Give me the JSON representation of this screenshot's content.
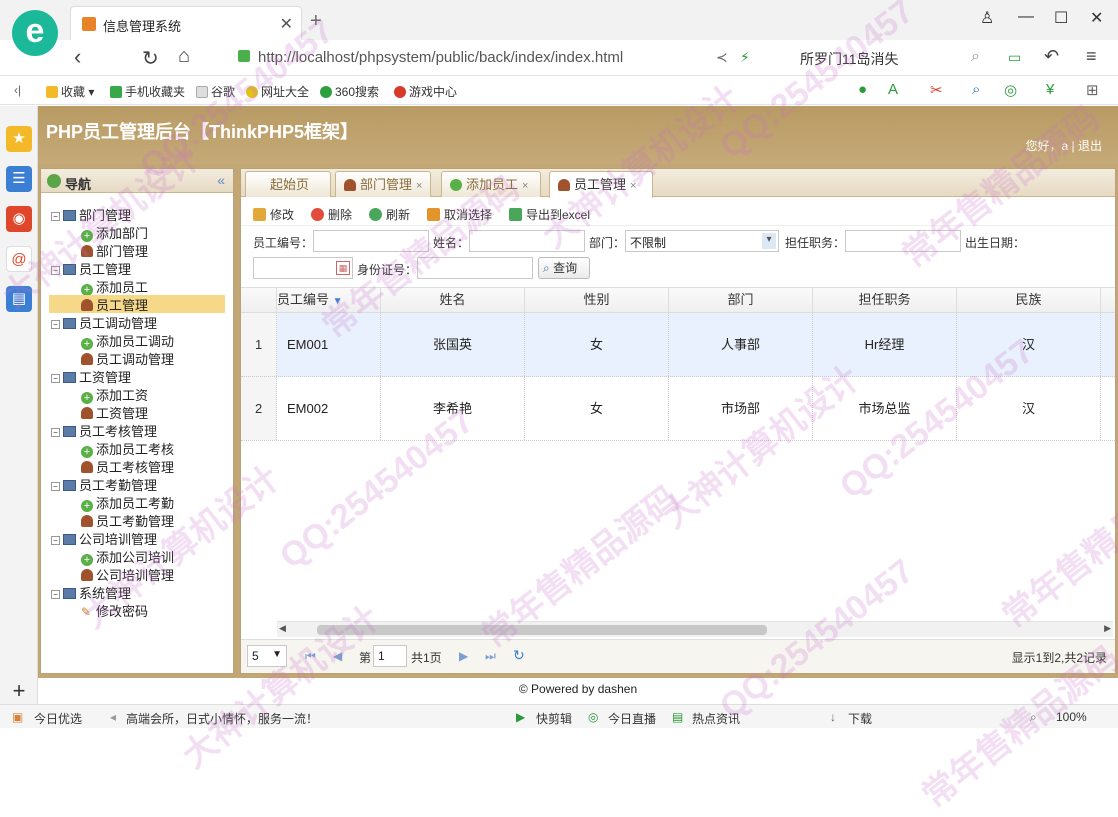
{
  "browser": {
    "tab_title": "信息管理系统",
    "url": "http://localhost/phpsystem/public/back/index/index.html",
    "search_text": "所罗门11岛消失",
    "bookmarks": [
      "收藏",
      "手机收藏夹",
      "谷歌",
      "网址大全",
      "360搜索",
      "游戏中心"
    ]
  },
  "app": {
    "title": "PHP员工管理后台【ThinkPHP5框架】",
    "greeting": "您好，a",
    "logout": "退出"
  },
  "nav": {
    "title": "导航",
    "collapse": "«",
    "items": [
      {
        "label": "部门管理",
        "level": 0
      },
      {
        "label": "添加部门",
        "level": 1,
        "icon": "add"
      },
      {
        "label": "部门管理",
        "level": 1,
        "icon": "user"
      },
      {
        "label": "员工管理",
        "level": 0
      },
      {
        "label": "添加员工",
        "level": 1,
        "icon": "add"
      },
      {
        "label": "员工管理",
        "level": 1,
        "icon": "user",
        "selected": true
      },
      {
        "label": "员工调动管理",
        "level": 0
      },
      {
        "label": "添加员工调动",
        "level": 1,
        "icon": "add"
      },
      {
        "label": "员工调动管理",
        "level": 1,
        "icon": "user"
      },
      {
        "label": "工资管理",
        "level": 0
      },
      {
        "label": "添加工资",
        "level": 1,
        "icon": "add"
      },
      {
        "label": "工资管理",
        "level": 1,
        "icon": "user"
      },
      {
        "label": "员工考核管理",
        "level": 0
      },
      {
        "label": "添加员工考核",
        "level": 1,
        "icon": "add"
      },
      {
        "label": "员工考核管理",
        "level": 1,
        "icon": "user"
      },
      {
        "label": "员工考勤管理",
        "level": 0
      },
      {
        "label": "添加员工考勤",
        "level": 1,
        "icon": "add"
      },
      {
        "label": "员工考勤管理",
        "level": 1,
        "icon": "user"
      },
      {
        "label": "公司培训管理",
        "level": 0
      },
      {
        "label": "添加公司培训",
        "level": 1,
        "icon": "add"
      },
      {
        "label": "公司培训管理",
        "level": 1,
        "icon": "user"
      },
      {
        "label": "系统管理",
        "level": 0
      },
      {
        "label": "修改密码",
        "level": 1,
        "icon": "key"
      }
    ]
  },
  "tabs": [
    {
      "label": "起始页"
    },
    {
      "label": "部门管理",
      "closable": true
    },
    {
      "label": "添加员工",
      "closable": true
    },
    {
      "label": "员工管理",
      "closable": true,
      "active": true
    }
  ],
  "toolbar": {
    "edit": "修改",
    "delete": "删除",
    "refresh": "刷新",
    "cancel_select": "取消选择",
    "export": "导出到excel"
  },
  "filters": {
    "emp_no_label": "员工编号：",
    "name_label": "姓名：",
    "dept_label": "部门：",
    "dept_value": "不限制",
    "position_label": "担任职务：",
    "birth_label": "出生日期：",
    "id_label": "身份证号：",
    "search_btn": "查询"
  },
  "grid": {
    "columns": [
      "员工编号",
      "姓名",
      "性别",
      "部门",
      "担任职务",
      "民族"
    ],
    "rows": [
      {
        "no": "1",
        "cells": [
          "EM001",
          "张国英",
          "女",
          "人事部",
          "Hr经理",
          "汉"
        ]
      },
      {
        "no": "2",
        "cells": [
          "EM002",
          "李希艳",
          "女",
          "市场部",
          "市场总监",
          "汉"
        ]
      }
    ]
  },
  "pager": {
    "page_size": "5",
    "page_prefix": "第",
    "page_value": "1",
    "page_total": "共1页",
    "summary": "显示1到2,共2记录"
  },
  "footer": "© Powered by dashen",
  "statusbar": {
    "left1": "今日优选",
    "left2": "高端会所，日式小情怀，服务一流！",
    "r1": "快剪辑",
    "r2": "今日直播",
    "r3": "热点资讯",
    "r4": "下载",
    "zoom": "100%"
  },
  "watermark": [
    "大神计算机设计",
    "QQ:254540457",
    "常年售精品源码"
  ]
}
